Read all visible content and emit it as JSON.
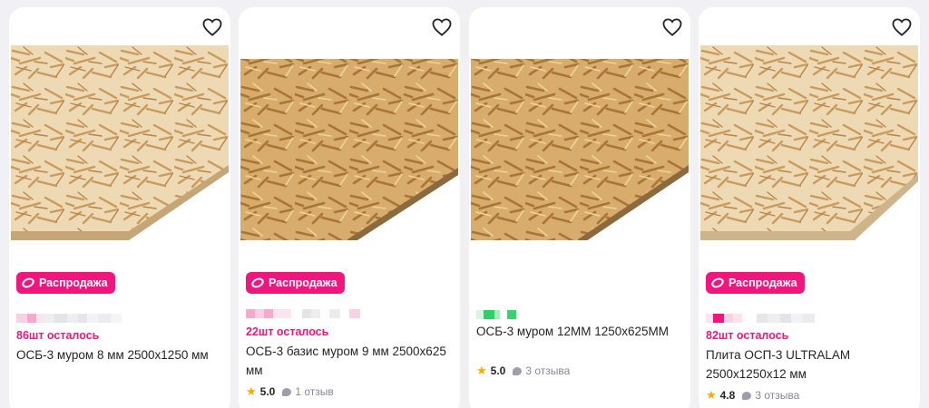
{
  "favorite_icon": "heart-outline-icon",
  "rating_icon": "star-icon",
  "reviews_icon": "speech-bubble-icon",
  "colors": {
    "accent": "#f0167d",
    "star": "#ffa800",
    "card": "#ffffff",
    "background": "#f1f1f5"
  },
  "products": [
    {
      "badge": "Распродажа",
      "stock": "86шт осталось",
      "title": "ОСБ-3 муром 8 мм 2500х1250 мм",
      "rating": "",
      "reviews": ""
    },
    {
      "badge": "Распродажа",
      "stock": "22шт осталось",
      "title": "ОСБ-3 базис муром 9 мм 2500х625 мм",
      "rating": "5.0",
      "reviews": "1 отзыв"
    },
    {
      "badge": "",
      "stock": "",
      "title": "ОСБ-3 муром 12ММ 1250х625ММ",
      "rating": "5.0",
      "reviews": "3 отзыва"
    },
    {
      "badge": "Распродажа",
      "stock": "82шт осталось",
      "title": "Плита ОСП-3 ULTRALAM 2500х1250х12 мм",
      "rating": "4.8",
      "reviews": "3 отзыва"
    }
  ]
}
